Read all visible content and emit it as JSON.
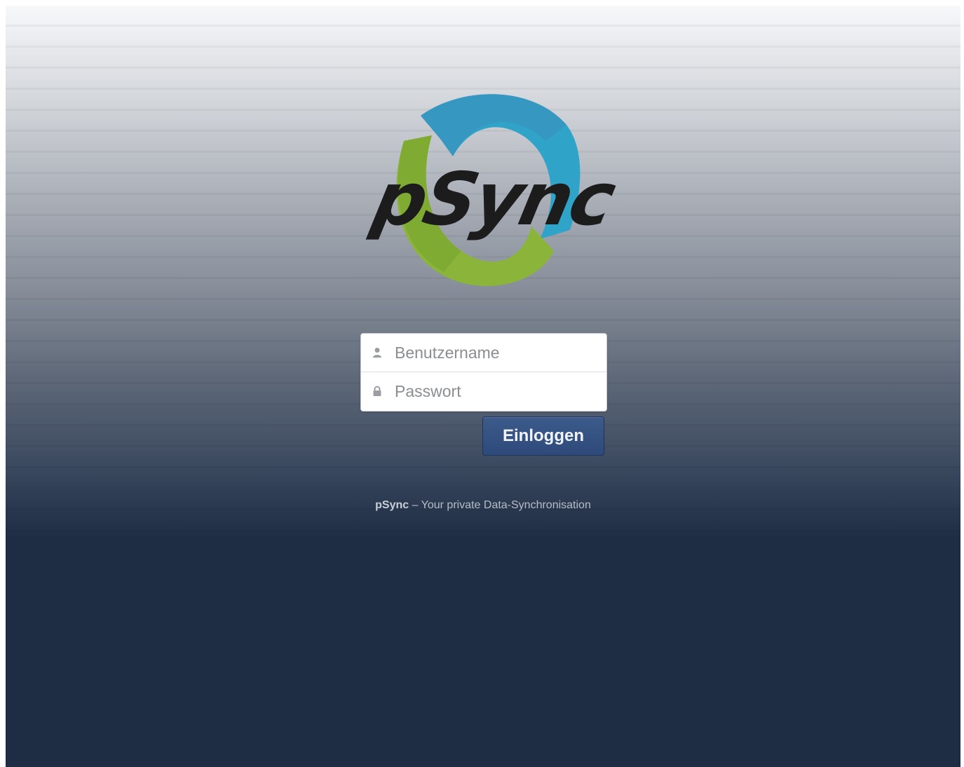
{
  "logo": {
    "brand_text": "pSync",
    "colors": {
      "blue": "#2fa3c8",
      "green": "#8ab53a",
      "text": "#1c1c1c"
    }
  },
  "login": {
    "username_placeholder": "Benutzername",
    "password_placeholder": "Passwort",
    "submit_label": "Einloggen",
    "username_icon": "user-icon",
    "password_icon": "lock-icon"
  },
  "footer": {
    "brand": "pSync",
    "tagline": " – Your private Data-Synchronisation"
  },
  "colors": {
    "background_dark": "#1e2c44",
    "button": "#2d4a7a"
  }
}
